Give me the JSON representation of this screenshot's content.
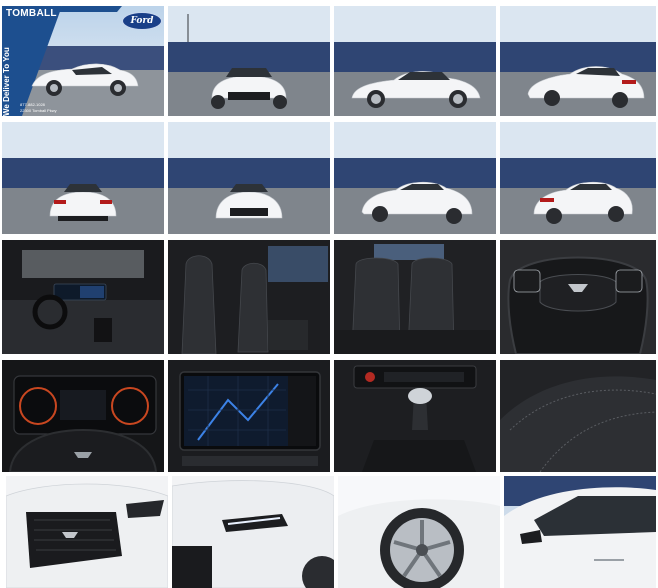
{
  "dealer": {
    "name": "TOMBALL",
    "brand": "Ford",
    "slogan": "We Deliver To You",
    "phone": "877-882-1028",
    "address": "22300 Tomball Pkwy"
  },
  "gallery": {
    "tiles": [
      {
        "kind": "exterior-front-left"
      },
      {
        "kind": "exterior-front"
      },
      {
        "kind": "exterior-side-left"
      },
      {
        "kind": "exterior-rear-left"
      },
      {
        "kind": "exterior-rear"
      },
      {
        "kind": "exterior-front-straight"
      },
      {
        "kind": "exterior-side-right"
      },
      {
        "kind": "exterior-rear-right"
      },
      {
        "kind": "interior-dashboard"
      },
      {
        "kind": "interior-front-seats"
      },
      {
        "kind": "interior-rear-seats"
      },
      {
        "kind": "steering-wheel"
      },
      {
        "kind": "instrument-cluster"
      },
      {
        "kind": "infotainment-screen"
      },
      {
        "kind": "shifter-console"
      },
      {
        "kind": "seat-stitching"
      },
      {
        "kind": "grille-detail"
      },
      {
        "kind": "headlight-detail"
      },
      {
        "kind": "wheel-detail"
      },
      {
        "kind": "mirror-detail"
      }
    ]
  },
  "colors": {
    "car_paint": "#f4f5f7",
    "dealer_blue": "#1d4f8f",
    "ford_blue": "#1a3f88"
  }
}
